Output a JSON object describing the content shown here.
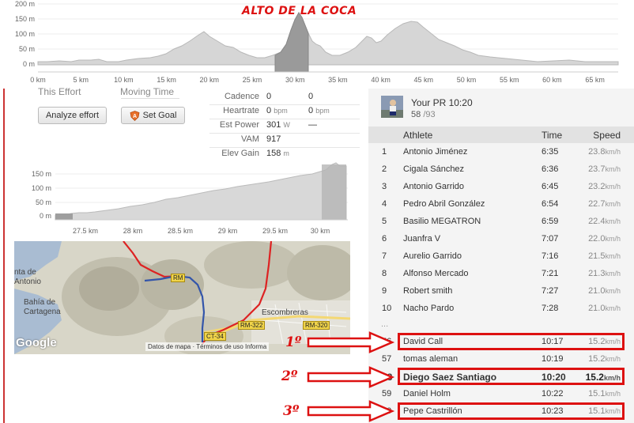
{
  "top_chart": {
    "title": "ALTO DE LA COCA",
    "y_ticks": [
      "200 m",
      "150 m",
      "100 m",
      "50 m",
      "0 m"
    ],
    "x_ticks": [
      "0 km",
      "5 km",
      "10 km",
      "15 km",
      "20 km",
      "25 km",
      "30 km",
      "35 km",
      "40 km",
      "45 km",
      "50 km",
      "55 km",
      "60 km",
      "65 km"
    ],
    "highlight_color": "#999999",
    "fill_color": "#d4d4d4"
  },
  "effort": {
    "this_effort_label": "This Effort",
    "moving_time_label": "Moving Time",
    "analyze_button": "Analyze effort",
    "set_goal_button": "Set Goal"
  },
  "stats": {
    "cadence": {
      "label": "Cadence",
      "v1": "0",
      "v2": "0"
    },
    "heartrate": {
      "label": "Heartrate",
      "v1": "0",
      "u1": "bpm",
      "v2": "0",
      "u2": "bpm"
    },
    "est_power": {
      "label": "Est Power",
      "v1": "301",
      "u1": "W",
      "v2": "—"
    },
    "vam": {
      "label": "VAM",
      "v1": "917"
    },
    "elev_gain": {
      "label": "Elev Gain",
      "v1": "158",
      "u1": "m"
    }
  },
  "segment_chart": {
    "y_ticks": [
      "150 m",
      "100 m",
      "50 m",
      "0 m"
    ],
    "x_ticks": [
      "27.5 km",
      "28 km",
      "28.5 km",
      "29 km",
      "29.5 km",
      "30 km"
    ]
  },
  "map": {
    "labels": {
      "bahia": "Bahía de",
      "cartagena": "Cartagena",
      "antonio1": "nta de",
      "antonio2": "Antonio",
      "escombreras": "Escombreras"
    },
    "roads": [
      "RM-322",
      "RM-320",
      "CT-34",
      "RM"
    ],
    "google": "Google",
    "footer": "Datos de mapa · Términos de uso  Informa"
  },
  "your_pr": {
    "title": "Your PR 10:20",
    "rank": "58",
    "total": "/93"
  },
  "leaderboard": {
    "headers": {
      "athlete": "Athlete",
      "time": "Time",
      "speed": "Speed"
    },
    "speed_unit": "km/h",
    "rows": [
      {
        "rank": "1",
        "name": "Antonio Jiménez",
        "time": "6:35",
        "speed": "23.8"
      },
      {
        "rank": "2",
        "name": "Cigala Sánchez",
        "time": "6:36",
        "speed": "23.7"
      },
      {
        "rank": "3",
        "name": "Antonio Garrido",
        "time": "6:45",
        "speed": "23.2"
      },
      {
        "rank": "4",
        "name": "Pedro Abril González",
        "time": "6:54",
        "speed": "22.7"
      },
      {
        "rank": "5",
        "name": "Basilio MEGATRON",
        "time": "6:59",
        "speed": "22.4"
      },
      {
        "rank": "6",
        "name": "Juanfra V",
        "time": "7:07",
        "speed": "22.0"
      },
      {
        "rank": "7",
        "name": "Aurelio Garrido",
        "time": "7:16",
        "speed": "21.5"
      },
      {
        "rank": "8",
        "name": "Alfonso Mercado",
        "time": "7:21",
        "speed": "21.3"
      },
      {
        "rank": "9",
        "name": "Robert smith",
        "time": "7:27",
        "speed": "21.0"
      },
      {
        "rank": "10",
        "name": "Nacho Pardo",
        "time": "7:28",
        "speed": "21.0"
      }
    ],
    "ellipsis": "...",
    "rows_bottom": [
      {
        "rank": "56",
        "name": "David Call",
        "time": "10:17",
        "speed": "15.2"
      },
      {
        "rank": "57",
        "name": "tomas aleman",
        "time": "10:19",
        "speed": "15.2"
      },
      {
        "rank": "58",
        "name": "Diego Saez Santiago",
        "time": "10:20",
        "speed": "15.2"
      },
      {
        "rank": "59",
        "name": "Daniel Holm",
        "time": "10:22",
        "speed": "15.1"
      },
      {
        "rank": "60",
        "name": "Pepe Castrillón",
        "time": "10:23",
        "speed": "15.1"
      }
    ]
  },
  "annotations": {
    "first": "1º",
    "second": "2º",
    "third": "3º",
    "color": "#dd1111"
  }
}
